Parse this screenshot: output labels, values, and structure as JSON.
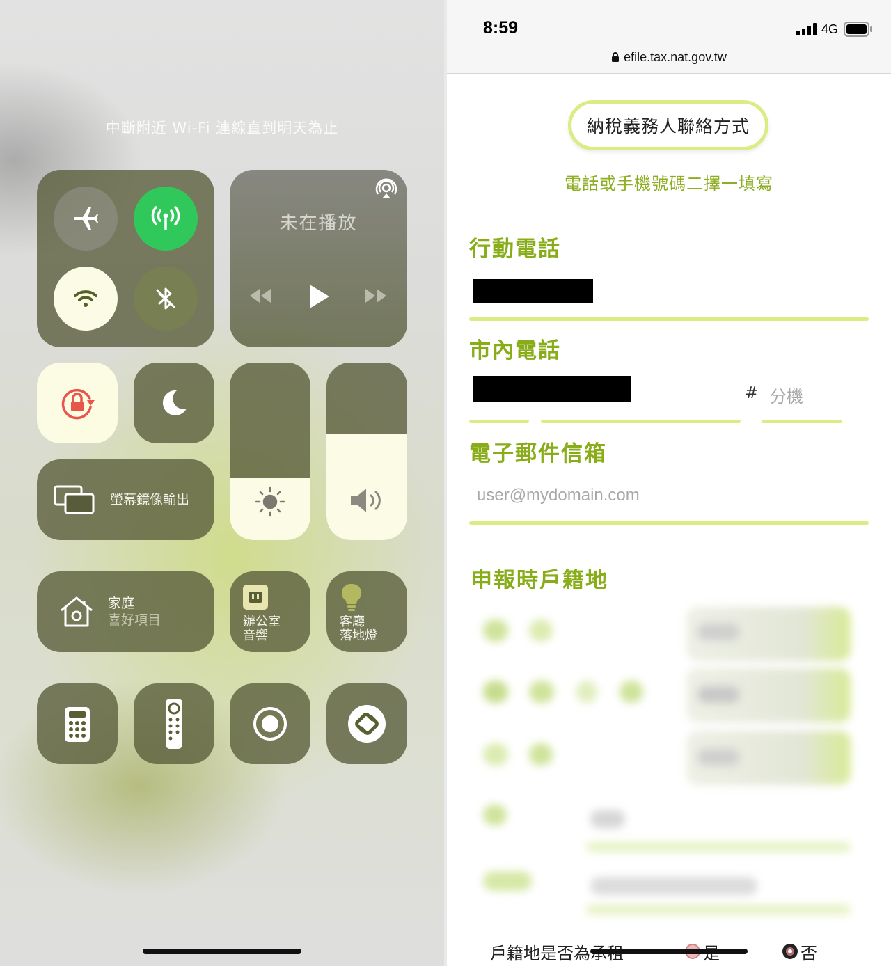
{
  "control_center": {
    "wifi_notice": "中斷附近 Wi-Fi 連線直到明天為止",
    "now_playing": "未在播放",
    "screen_mirroring": "螢幕鏡像輸出",
    "home": {
      "title": "家庭",
      "subtitle": "喜好項目"
    },
    "accessory_office": {
      "line1": "辦公室",
      "line2": "音響"
    },
    "accessory_living": {
      "line1": "客廳",
      "line2": "落地燈"
    },
    "brightness_level": 0.35,
    "volume_level": 0.6,
    "icons": [
      "airplane-icon",
      "cellular-icon",
      "wifi-icon",
      "bluetooth-icon",
      "airplay-icon",
      "rewind-icon",
      "play-icon",
      "fast-forward-icon",
      "orientation-lock-icon",
      "moon-icon",
      "screen-mirroring-icon",
      "sun-icon",
      "speaker-icon",
      "home-icon",
      "outlet-icon",
      "lightbulb-icon",
      "calculator-icon",
      "remote-icon",
      "screen-record-icon",
      "shazam-icon"
    ],
    "colors": {
      "cellular_on": "#30c85a",
      "wifi_on_bg": "#fbfbe6",
      "lock_red": "#e8554a"
    }
  },
  "browser": {
    "status": {
      "time": "8:59",
      "network": "4G"
    },
    "url": "efile.tax.nat.gov.tw"
  },
  "form": {
    "header": "納稅義務人聯絡方式",
    "note": "電話或手機號碼二擇一填寫",
    "mobile_label": "行動電話",
    "landline_label": "市內電話",
    "ext_hash": "#",
    "ext_placeholder": "分機",
    "email_label": "電子郵件信箱",
    "email_placeholder": "user@mydomain.com",
    "household_label": "申報時戶籍地",
    "rent_question": "戶籍地是否為承租",
    "rent_yes": "是",
    "rent_no": "否",
    "colors": {
      "accent": "#88ad18",
      "underline": "#d9ed84"
    }
  }
}
